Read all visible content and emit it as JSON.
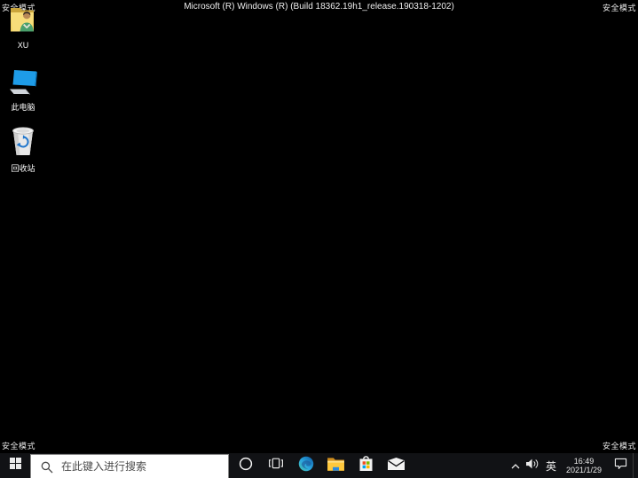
{
  "system": {
    "safe_mode_label": "安全模式",
    "build_banner": "Microsoft (R) Windows (R) (Build 18362.19h1_release.190318-1202)"
  },
  "desktop": {
    "icons": [
      {
        "id": "user-folder",
        "label": "XU"
      },
      {
        "id": "this-pc",
        "label": "此电脑"
      },
      {
        "id": "recycle-bin",
        "label": "回收站"
      }
    ]
  },
  "taskbar": {
    "search": {
      "placeholder": "在此键入进行搜索"
    },
    "icons": [
      "start",
      "cortana",
      "task-view",
      "edge",
      "file-explorer",
      "microsoft-store",
      "mail"
    ],
    "tray": {
      "icons": [
        "hidden-icons-chevron",
        "speaker",
        "ime",
        "clock",
        "action-center",
        "show-desktop"
      ],
      "ime_label": "英",
      "clock": {
        "time": "16:49",
        "date": "2021/1/29"
      }
    }
  },
  "colors": {
    "desktop_bg": "#000000",
    "taskbar_bg": "#111215",
    "folder_yellow": "#ffc83d",
    "explorer_blue": "#2a8ae0",
    "monitor_blue": "#1e9ce8",
    "store_red": "#f25022",
    "store_green": "#7fba00",
    "store_blue": "#00a4ef",
    "store_yellow": "#ffb900",
    "edge_teal": "#45c1a9",
    "edge_blue": "#0c59a4"
  }
}
